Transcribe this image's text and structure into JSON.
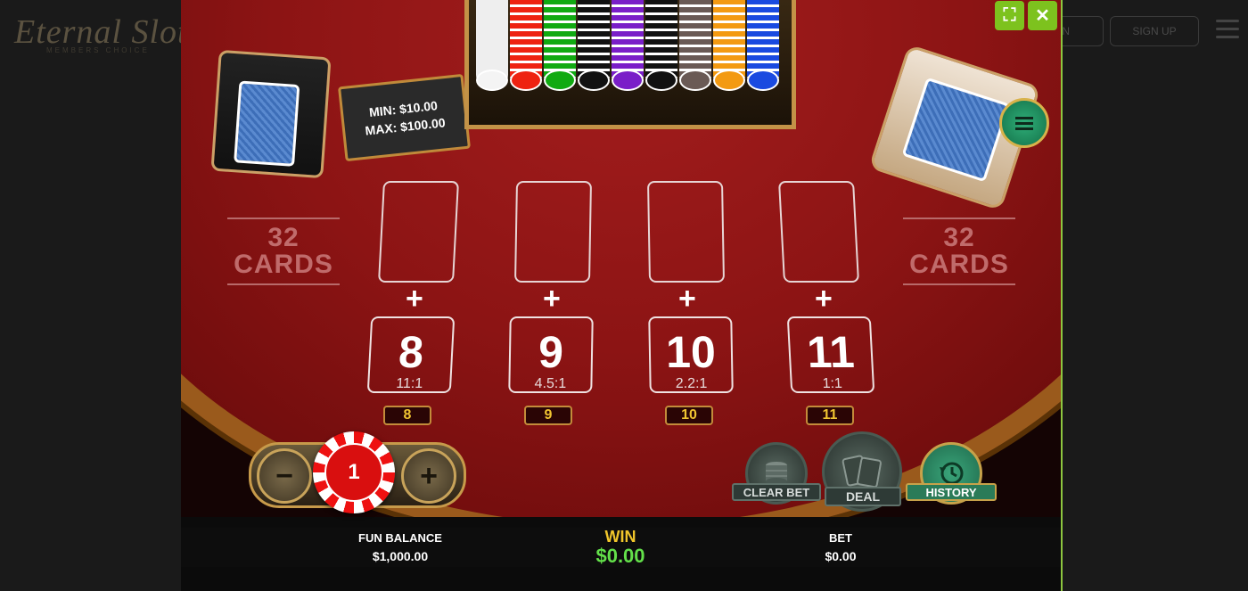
{
  "site": {
    "logo": "Eternal Slots",
    "logo_sub": "MEMBERS CHOICE",
    "login_label": "IN",
    "signup_label": "SIGN UP"
  },
  "game": {
    "limits": {
      "min": "MIN: $10.00",
      "max": "MAX: $100.00"
    },
    "cards_left": {
      "count": "32",
      "label": "CARDS"
    },
    "cards_right": {
      "count": "32",
      "label": "CARDS"
    },
    "plus_sign": "+",
    "bets": [
      {
        "number": "8",
        "odds": "11:1",
        "tag": "8"
      },
      {
        "number": "9",
        "odds": "4.5:1",
        "tag": "9"
      },
      {
        "number": "10",
        "odds": "2.2:1",
        "tag": "10"
      },
      {
        "number": "11",
        "odds": "1:1",
        "tag": "11"
      }
    ],
    "chip": {
      "value": "1",
      "minus": "−",
      "plus": "+"
    },
    "buttons": {
      "clear_bet": "CLEAR BET",
      "deal": "DEAL",
      "history": "HISTORY",
      "expand_icon": "⛶",
      "close_icon": "✕"
    },
    "status": {
      "balance_label": "FUN BALANCE",
      "balance_value": "$1,000.00",
      "win_label": "WIN",
      "win_value": "$0.00",
      "bet_label": "BET",
      "bet_value": "$0.00"
    }
  },
  "colors": {
    "felt": "#8c1414",
    "accent_green": "#7dc21e",
    "gold": "#c39247",
    "win_text": "#63e04a"
  }
}
